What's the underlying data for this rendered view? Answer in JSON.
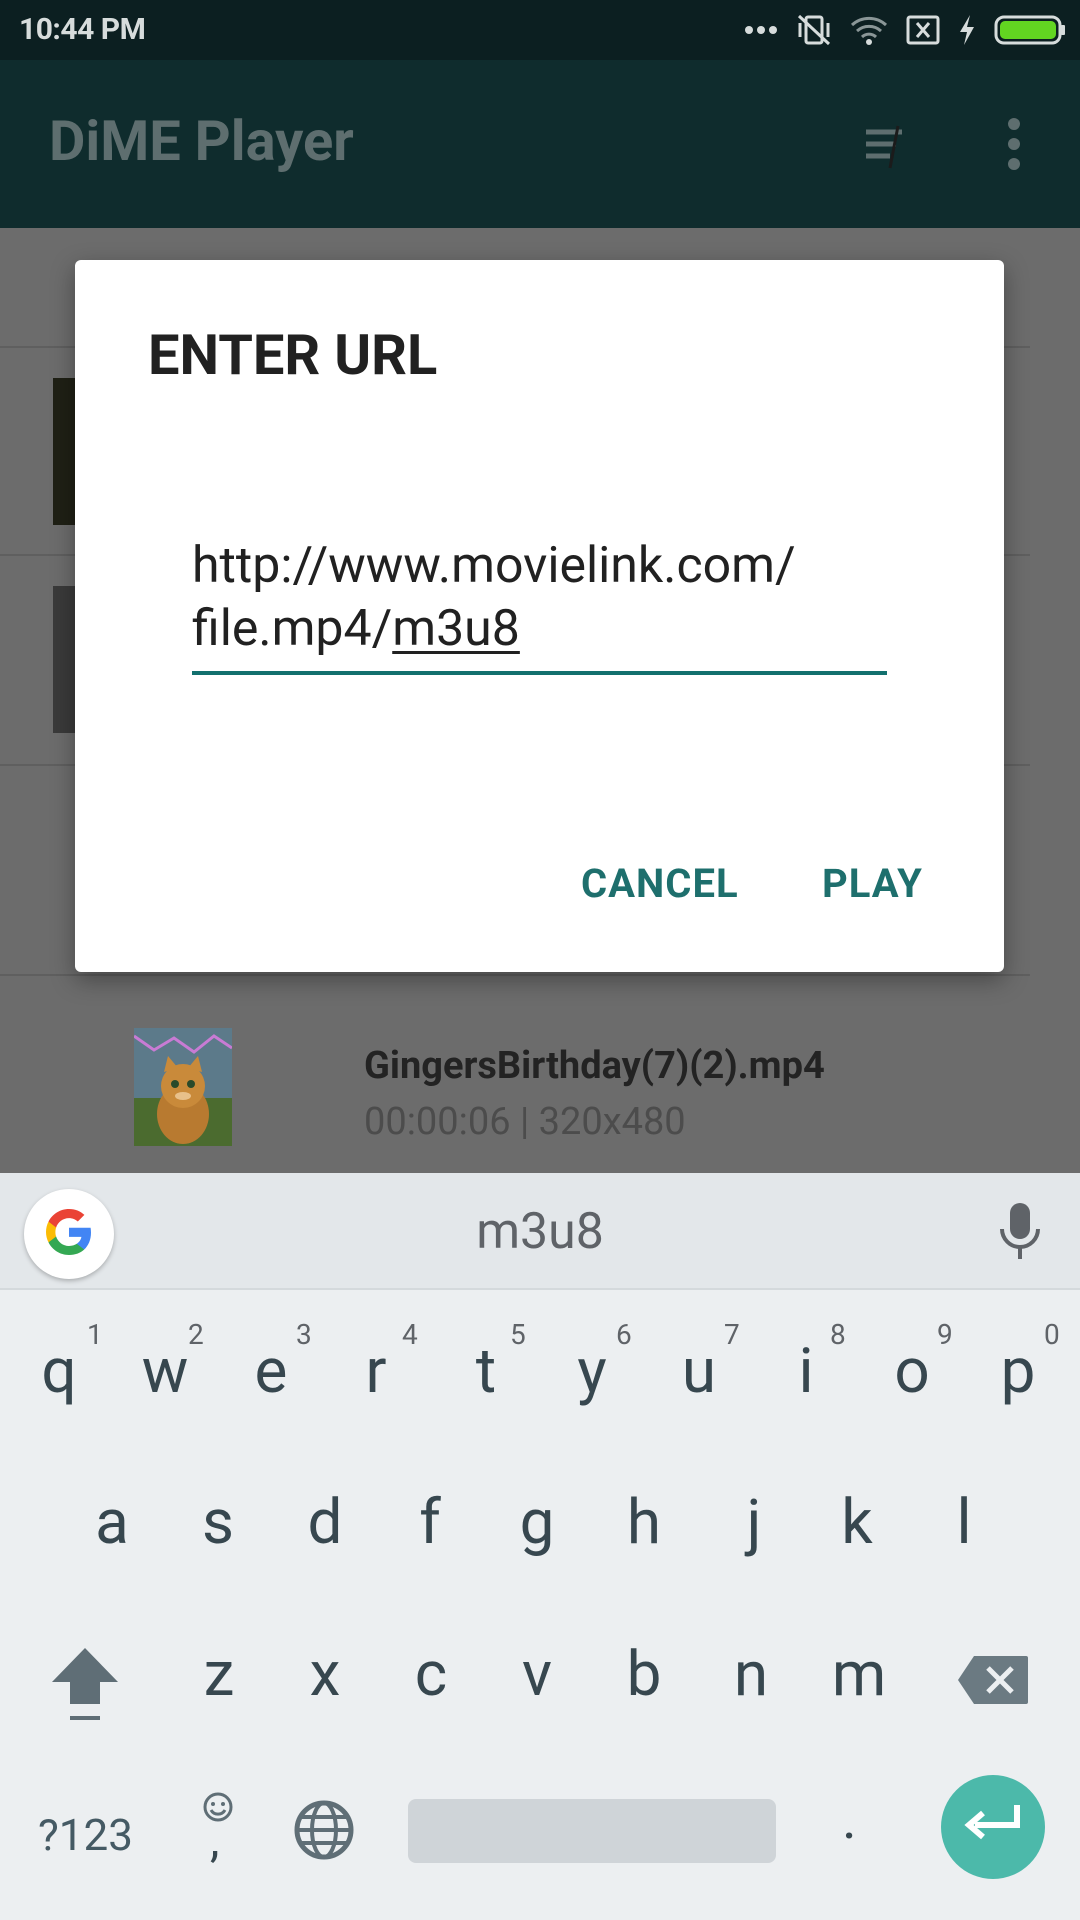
{
  "status_bar": {
    "time": "10:44 PM",
    "icons": [
      "more-dots-icon",
      "vibrate-off-icon",
      "wifi-icon",
      "no-sim-icon",
      "charging-icon",
      "battery-icon"
    ],
    "battery_color": "#62d521"
  },
  "app_bar": {
    "title": "DiME Player",
    "background": "#0f2c2d",
    "actions": [
      "sort-icon",
      "more-vert-icon"
    ]
  },
  "background_list": {
    "video_item": {
      "name": "GingersBirthday(7)(2).mp4",
      "meta": "00:00:06 | 320x480"
    }
  },
  "dialog": {
    "title": "ENTER URL",
    "url_line1": "http://www.movielink.com/",
    "url_line2_prefix": "file.mp4/",
    "url_line2_composing": "m3u8",
    "cancel_label": "CANCEL",
    "play_label": "PLAY",
    "accent_color": "#12706e"
  },
  "keyboard": {
    "suggestion": "m3u8",
    "row1": [
      "q",
      "w",
      "e",
      "r",
      "t",
      "y",
      "u",
      "i",
      "o",
      "p"
    ],
    "row1_hints": [
      "1",
      "2",
      "3",
      "4",
      "5",
      "6",
      "7",
      "8",
      "9",
      "0"
    ],
    "row2": [
      "a",
      "s",
      "d",
      "f",
      "g",
      "h",
      "j",
      "k",
      "l"
    ],
    "row3": [
      "z",
      "x",
      "c",
      "v",
      "b",
      "n",
      "m"
    ],
    "symbols_label": "?123",
    "emoji_comma": ",",
    "period": ".",
    "enter_color": "#4cb9aa"
  }
}
